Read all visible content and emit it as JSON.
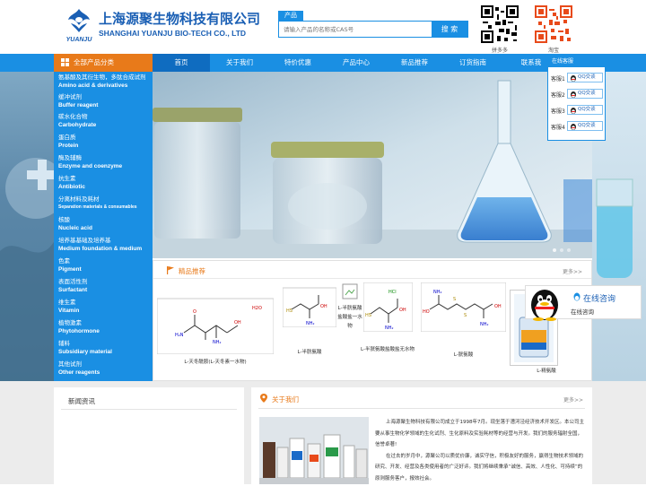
{
  "header": {
    "logo_text": "YUANJU",
    "company_cn": "上海源聚生物科技有限公司",
    "company_en": "SHANGHAI YUANJU BIO-TECH CO., LTD",
    "search_tab": "产品",
    "search_placeholder": "请输入产品的名称或CAS号",
    "search_button": "搜 索",
    "qr_codes": [
      {
        "caption": "拼多多"
      },
      {
        "caption": "淘宝"
      }
    ]
  },
  "nav": {
    "category_label": "全部产品分类",
    "items": [
      "首页",
      "关于我们",
      "特价优惠",
      "产品中心",
      "新品推荐",
      "订货指南",
      "联系我"
    ]
  },
  "categories": [
    {
      "cn": "氨基酸及其衍生物，多肽合成试剂",
      "en": "Amino acid & derivatives"
    },
    {
      "cn": "缓冲试剂",
      "en": "Buffer reagent"
    },
    {
      "cn": "碳水化合物",
      "en": "Carbohydrate"
    },
    {
      "cn": "蛋白质",
      "en": "Protein"
    },
    {
      "cn": "酶及辅酶",
      "en": "Enzyme and coenzyme"
    },
    {
      "cn": "抗生素",
      "en": "Antibiotic"
    },
    {
      "cn": "分离材料及耗材",
      "en": "Separation materials & consumables"
    },
    {
      "cn": "核酸",
      "en": "Nucleic acid"
    },
    {
      "cn": "培养基基础及培养基",
      "en": "Medium foundation & medium"
    },
    {
      "cn": "色素",
      "en": "Pigment"
    },
    {
      "cn": "表面活性剂",
      "en": "Surfactant"
    },
    {
      "cn": "维生素",
      "en": "Vitamin"
    },
    {
      "cn": "植物激素",
      "en": "Phytohormone"
    },
    {
      "cn": "辅料",
      "en": "Subsidiary material"
    },
    {
      "cn": "其他试剂",
      "en": "Other reagents"
    }
  ],
  "featured": {
    "title": "精品推荐",
    "more": "更多>>",
    "products": [
      {
        "caption": "L-天冬酰胺(L-天冬素一水物)",
        "formula_label": "H2O"
      },
      {
        "caption": "L-半胱氨酸"
      },
      {
        "caption": "L-半胱氨酸盐酸盐一水物"
      },
      {
        "caption": "L-半胱氨酸盐酸盐无水物"
      },
      {
        "caption": "L-胱氨酸"
      },
      {
        "caption": "L-精氨酸"
      }
    ]
  },
  "service": {
    "title": "在线客服",
    "rows": [
      {
        "label": "客服1",
        "button": "QQ交谈"
      },
      {
        "label": "客服2",
        "button": "QQ交谈"
      },
      {
        "label": "客服3",
        "button": "QQ交谈"
      },
      {
        "label": "客服4",
        "button": "QQ交谈"
      }
    ]
  },
  "consult": {
    "title": "在线咨询",
    "subtitle": "在线咨询"
  },
  "news": {
    "title": "新闻资讯"
  },
  "about": {
    "title": "关于我们",
    "more": "更多>>",
    "paragraphs": [
      "上海源聚生物科技有限公司成立于1998年7月。现坐落于漕河泾经济技术开发区。本公司主要从事生物化学领域的生化试剂、生化原料及实验耗材等的经营与开发。我们的服务辐射全国，信誉卓著!",
      "在过去的岁月中，源聚公司以质优价廉，诚实守信，积极友好的服务，赢得生物技术领域的研究、开发、经营及各类使用者的广泛好评。我们将继续秉承“诚信、高效、人性化、可持续”的原则服务客户，报效社会。"
    ]
  },
  "colors": {
    "primary": "#1a8fe3",
    "accent": "#e87a1a",
    "brand": "#1a5fb4"
  }
}
